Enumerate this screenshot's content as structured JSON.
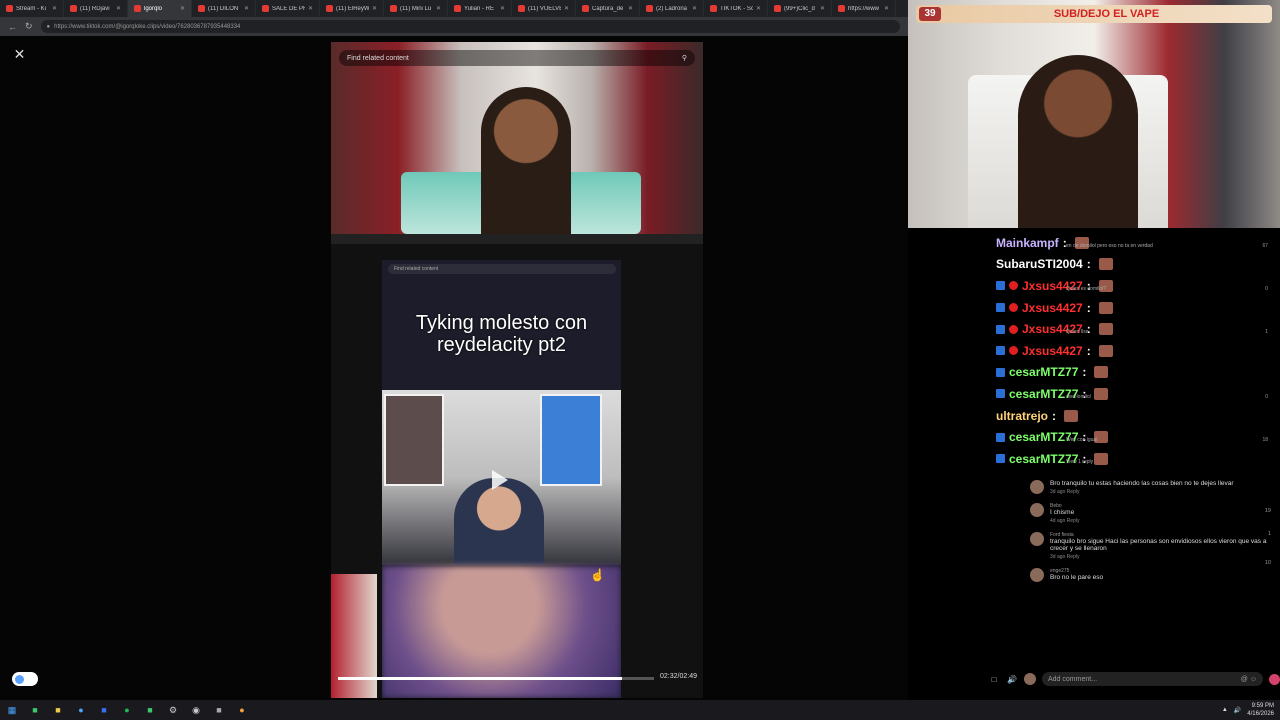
{
  "browser": {
    "tabs": [
      {
        "label": "Stream - Ki"
      },
      {
        "label": "(11) RDjavi"
      },
      {
        "label": "lgorqlo"
      },
      {
        "label": "(11) DILON"
      },
      {
        "label": "SALE DE PRI"
      },
      {
        "label": "(11) ElReyW"
      },
      {
        "label": "(11) Mini Lu"
      },
      {
        "label": "Yulian - RE"
      },
      {
        "label": "(11) VUELVE"
      },
      {
        "label": "Captura_de"
      },
      {
        "label": "(2) Ladrona"
      },
      {
        "label": "TIKTOK - Sc"
      },
      {
        "label": "(99+)Clic_d"
      },
      {
        "label": "https://www"
      }
    ],
    "url": "https://www.tiktok.com/@igorqloke.clips/video/7628036787935448334"
  },
  "video": {
    "search_placeholder": "Find related content",
    "inner_search_placeholder": "Find related content",
    "caption": "Tyking molesto con reydelacity pt2",
    "time": "02:32/02:49",
    "progress": 0.9
  },
  "cam": {
    "count": "39",
    "banner": "SUB/DEJO EL VAPE"
  },
  "chat": [
    {
      "user": "Mainkampf",
      "color": "#c9b3ff",
      "badge": false,
      "faint": "en de domilol pero eso no ta en verdad",
      "likes": "67"
    },
    {
      "user": "SubaruSTI2004",
      "color": "#ffffff",
      "badge": false,
      "faint": "",
      "likes": ""
    },
    {
      "user": "Jxsus4427",
      "color": "#ff3030",
      "badge": true,
      "faint": "Quien es domilol?",
      "likes": "0"
    },
    {
      "user": "Jxsus4427",
      "color": "#ff3030",
      "badge": true,
      "faint": "",
      "likes": ""
    },
    {
      "user": "Jxsus4427",
      "color": "#ff3030",
      "badge": true,
      "faint": "Quien Ilse",
      "likes": "1"
    },
    {
      "user": "Jxsus4427",
      "color": "#ff3030",
      "badge": true,
      "faint": "",
      "likes": ""
    },
    {
      "user": "cesarMTZ77",
      "color": "#7dff6a",
      "badge": true,
      "faint": "",
      "likes": ""
    },
    {
      "user": "cesarMTZ77",
      "color": "#7dff6a",
      "badge": true,
      "faint": "dise lomilol",
      "likes": "0"
    },
    {
      "user": "ultratrejo",
      "color": "#ffd27a",
      "badge": false,
      "faint": "",
      "likes": ""
    },
    {
      "user": "cesarMTZ77",
      "color": "#7dff6a",
      "badge": true,
      "faint": "Wey con igual",
      "likes": "18"
    },
    {
      "user": "cesarMTZ77",
      "color": "#7dff6a",
      "badge": true,
      "faint": "View 1 reply",
      "likes": ""
    }
  ],
  "comments": [
    {
      "who": "",
      "text": "Bro tranquilo tu estas haciendo las cosas bien no te dejes llevar",
      "meta": "3d ago  Reply",
      "likes": "19"
    },
    {
      "who": "Bebo",
      "text": "I chisme",
      "meta": "4d ago  Reply",
      "likes": "1"
    },
    {
      "who": "Ford fiesta",
      "text": "tranquilo bro sigue Haci las personas son envidiosos ellos vieron que vas a crecer y se llenaron",
      "meta": "3d ago  Reply",
      "likes": "10"
    },
    {
      "who": "enge275",
      "text": "Bro no le pare eso",
      "meta": "",
      "likes": ""
    }
  ],
  "comment_input": {
    "placeholder": "Add comment..."
  },
  "taskbar": {
    "time": "9:59 PM",
    "date": "4/16/2026"
  },
  "colors": {
    "accent": "#d4436b",
    "banner_text": "#d32020"
  }
}
